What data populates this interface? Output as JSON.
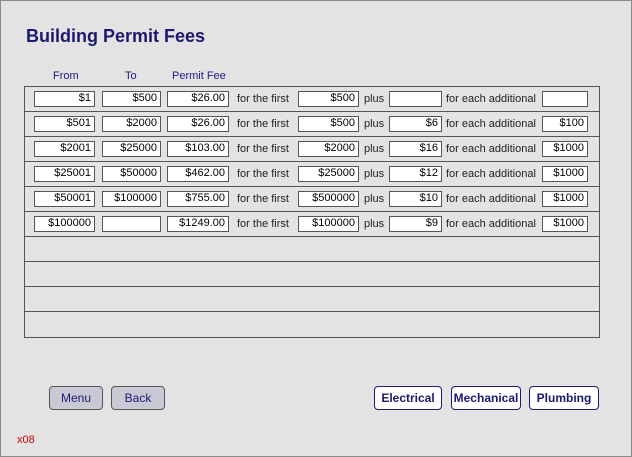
{
  "page": {
    "title": "Building Permit Fees",
    "code": "x08"
  },
  "columns": {
    "from": "From",
    "to": "To",
    "fee": "Permit Fee"
  },
  "labels": {
    "for_first": "for the first",
    "plus": "plus",
    "each_additional": "for each additional"
  },
  "rows": [
    {
      "from": "$1",
      "to": "$500",
      "fee": "$26.00",
      "first": "$500",
      "plus": "",
      "each": ""
    },
    {
      "from": "$501",
      "to": "$2000",
      "fee": "$26.00",
      "first": "$500",
      "plus": "$6",
      "each": "$100"
    },
    {
      "from": "$2001",
      "to": "$25000",
      "fee": "$103.00",
      "first": "$2000",
      "plus": "$16",
      "each": "$1000"
    },
    {
      "from": "$25001",
      "to": "$50000",
      "fee": "$462.00",
      "first": "$25000",
      "plus": "$12",
      "each": "$1000"
    },
    {
      "from": "$50001",
      "to": "$100000",
      "fee": "$755.00",
      "first": "$500000",
      "plus": "$10",
      "each": "$1000"
    },
    {
      "from": "$100000",
      "to": "",
      "fee": "$1249.00",
      "first": "$100000",
      "plus": "$9",
      "each": "$1000"
    }
  ],
  "buttons": {
    "menu": "Menu",
    "back": "Back",
    "electrical": "Electrical",
    "mechanical": "Mechanical",
    "plumbing": "Plumbing"
  }
}
